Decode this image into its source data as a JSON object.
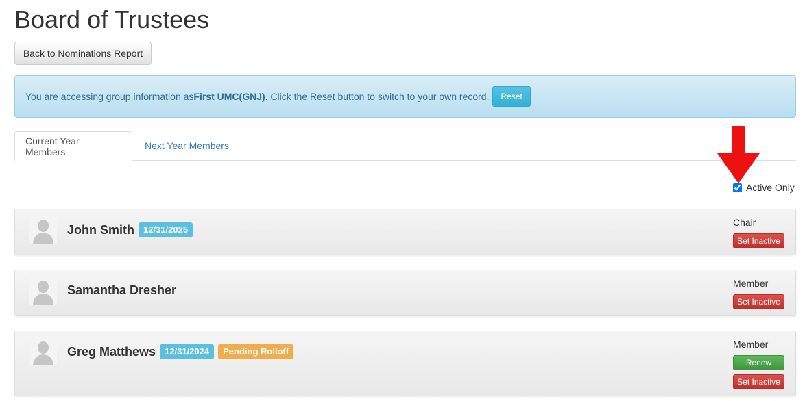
{
  "page": {
    "title": "Board of Trustees"
  },
  "back_button": {
    "label": "Back to Nominations Report"
  },
  "alert": {
    "prefix": "You are accessing group information as ",
    "group": "First UMC(GNJ)",
    "suffix": ". Click the Reset button to switch to your own record.",
    "reset_label": "Reset"
  },
  "tabs": [
    {
      "label": "Current Year Members",
      "active": true
    },
    {
      "label": "Next Year Members",
      "active": false
    }
  ],
  "filter": {
    "active_only_label": "Active Only",
    "active_only_checked": true
  },
  "members": [
    {
      "name": "John Smith",
      "date_badge": "12/31/2025",
      "status_badge": "",
      "role": "Chair",
      "renew_label": "",
      "inactive_label": "Set Inactive"
    },
    {
      "name": "Samantha Dresher",
      "date_badge": "",
      "status_badge": "",
      "role": "Member",
      "renew_label": "",
      "inactive_label": "Set Inactive"
    },
    {
      "name": "Greg Matthews",
      "date_badge": "12/31/2024",
      "status_badge": "Pending Rolloff",
      "role": "Member",
      "renew_label": "Renew",
      "inactive_label": "Set Inactive"
    }
  ],
  "colors": {
    "annotation_arrow": "#ee1111",
    "info_badge": "#5bc0de",
    "warning_badge": "#f0ad4e",
    "danger_button": "#d9534f",
    "success_button": "#5cb85c",
    "link": "#337ab7"
  },
  "icons": {
    "avatar": "default-person-icon",
    "annotation": "red-arrow-down-icon"
  }
}
